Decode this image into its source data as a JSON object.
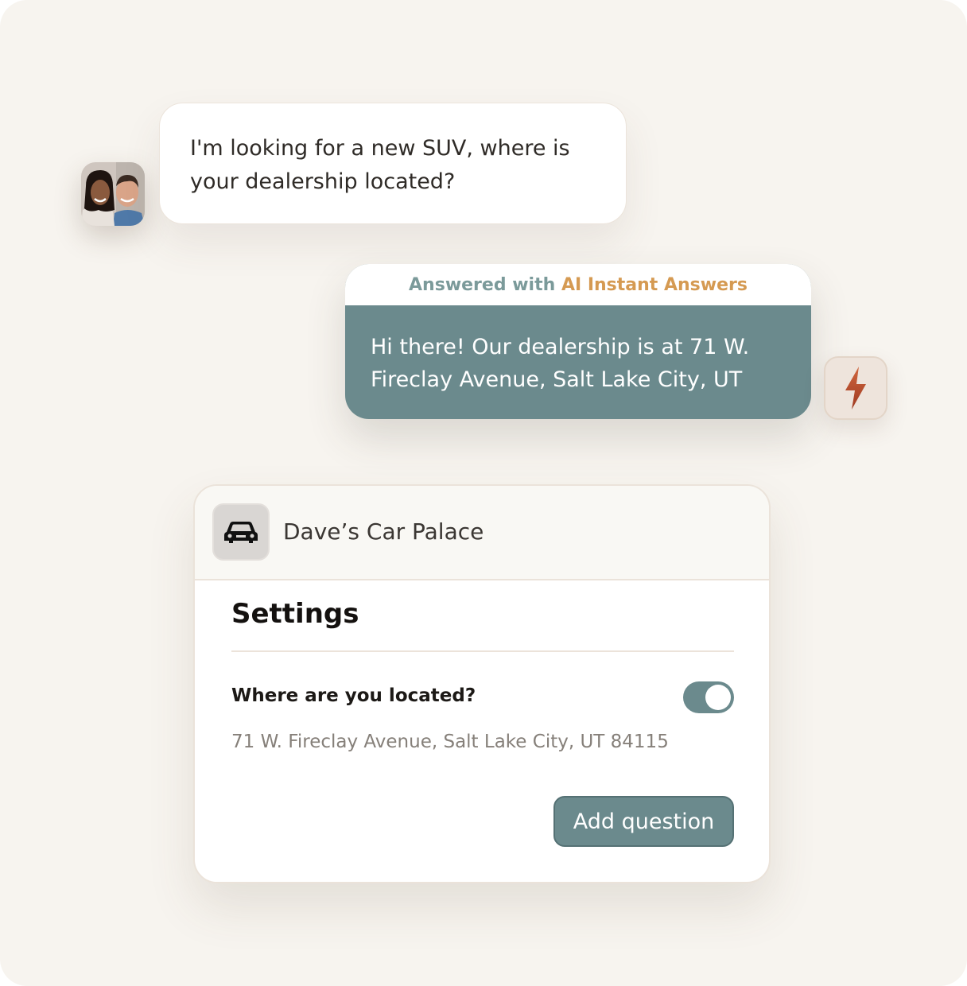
{
  "customer_message": {
    "text": "I'm looking for a new SUV, where is your dealership located?",
    "avatar_icon": "couple-avatar-icon"
  },
  "ai_reply": {
    "header_prefix": "Answered with",
    "header_brand": "AI Instant Answers",
    "text": "Hi there! Our dealership is at 71 W. Fireclay Avenue, Salt Lake City, UT",
    "badge_icon": "lightning-bolt-icon"
  },
  "settings_card": {
    "business_name": "Dave’s Car Palace",
    "business_icon": "car-icon",
    "title": "Settings",
    "question": "Where are you located?",
    "toggle_on": true,
    "answer": "71 W. Fireclay Avenue, Salt Lake City, UT 84115",
    "add_button_label": "Add question"
  },
  "colors": {
    "background": "#f7f4ef",
    "accent": "#6b8a8d",
    "bolt": "#c2522f"
  }
}
